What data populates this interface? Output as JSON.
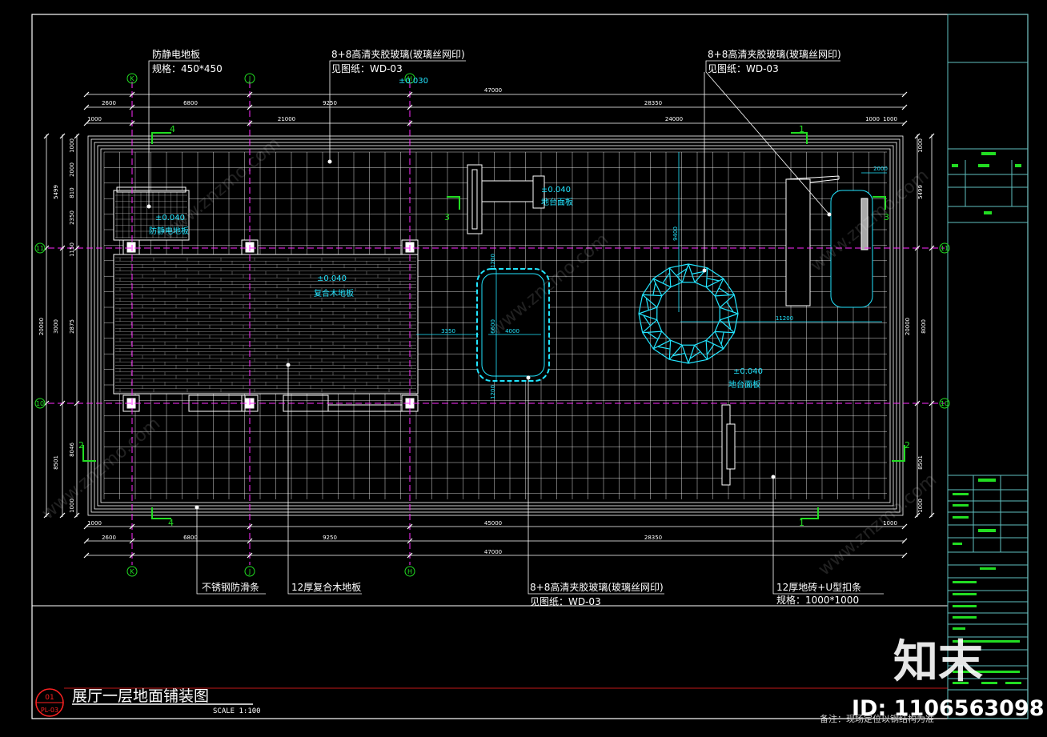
{
  "labels": {
    "static_floor": "防静电地板",
    "static_floor_spec": "规格：450*450",
    "glass_top_center": "8+8高清夹胶玻璃(玻璃丝网印)",
    "glass_top_center_ref": "见图纸：WD-03",
    "glass_top_right": "8+8高清夹胶玻璃(玻璃丝网印)",
    "glass_top_right_ref": "见图纸：WD-03",
    "glass_bottom": "8+8高清夹胶玻璃(玻璃丝网印)",
    "glass_bottom_ref": "见图纸：WD-03",
    "steel_strip": "不锈钢防滑条",
    "wood_floor": "12厚复合木地板",
    "floor_tile": "12厚地砖+U型扣条",
    "floor_tile_spec": "规格：1000*1000"
  },
  "annotations": {
    "elev_top": "±0.030",
    "elev_static": "±0.040",
    "static_tag": "防静电地板",
    "elev_wood": "±0.040",
    "wood_tag": "复合木地板",
    "elev_stage": "±0.040",
    "stage_tag": "地台面板",
    "elev_tile": "±0.040",
    "tile_tag": "地台面板"
  },
  "axes": {
    "K": "K",
    "J": "J",
    "H": "H",
    "n11": "11",
    "n10": "10"
  },
  "dimensions": {
    "top_total": "47000",
    "top_row1": [
      "2600",
      "6800",
      "9250",
      "28350"
    ],
    "top_row2": [
      "1000",
      "21000",
      "24000",
      "1000",
      "1000"
    ],
    "bottom_row1": [
      "1000",
      "45000",
      "1000"
    ],
    "bottom_row2": [
      "2600",
      "6800",
      "9250",
      "28350"
    ],
    "bottom_total": "47000",
    "left": [
      "1000",
      "2000",
      "5499",
      "810",
      "2350",
      "1150",
      "20000",
      "3000",
      "2875",
      "8046",
      "8501",
      "1000"
    ],
    "right": [
      "1000",
      "5499",
      "20000",
      "8000",
      "8501",
      "1000"
    ],
    "inner": [
      "2000",
      "11200",
      "3350",
      "4000",
      "6600",
      "1200",
      "1200",
      "9400"
    ]
  },
  "section_marks": [
    "4",
    "1",
    "3",
    "3",
    "2",
    "2",
    "4",
    "1"
  ],
  "title": {
    "main": "展厅一层地面铺装图",
    "scale": "SCALE 1:100",
    "badge_top": "01",
    "badge_bottom": "PL-03"
  },
  "note": "备注：现场定位以钢结构为准",
  "watermark": {
    "brand": "知末",
    "id": "ID: 1106563098",
    "url": "www.znzmo.com"
  },
  "colors": {
    "background": "#000000",
    "line": "#ffffff",
    "cyan": "#22e5ff",
    "magenta": "#ff2bff",
    "green": "#22dd22",
    "frame_cyan": "#5fbfbf",
    "red": "#ff2222"
  }
}
